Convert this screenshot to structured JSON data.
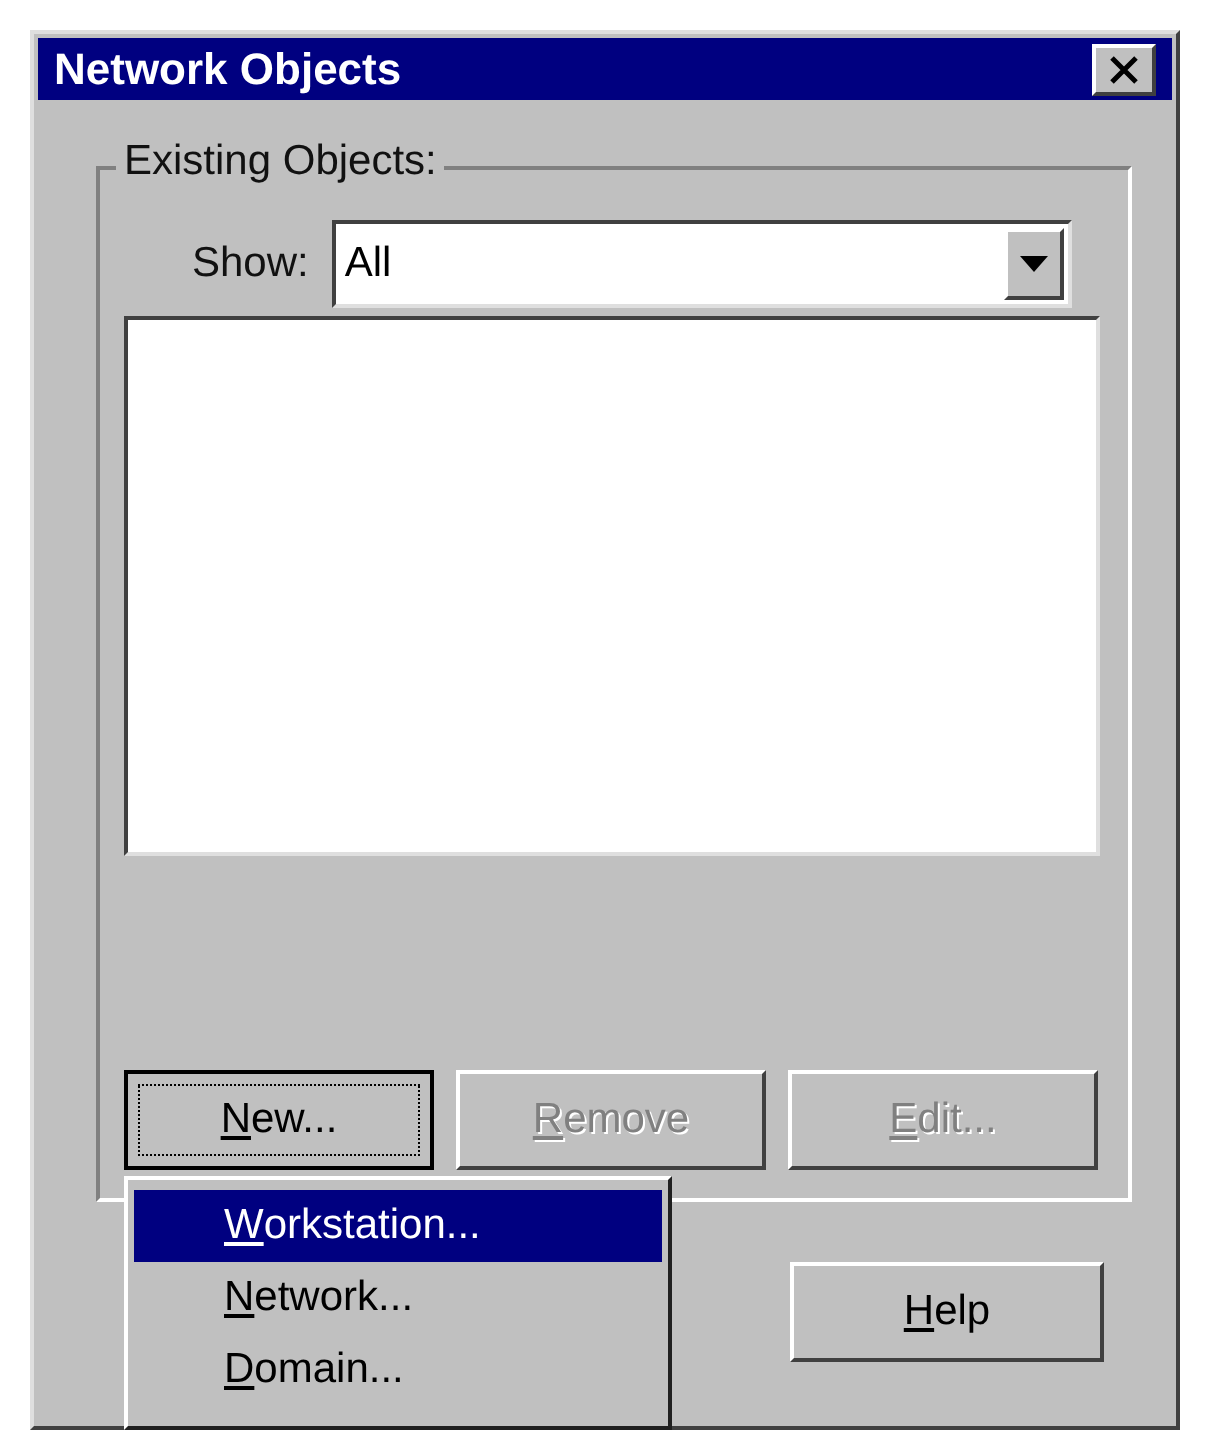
{
  "window": {
    "title": "Network Objects"
  },
  "group": {
    "title": "Existing Objects:",
    "show_label": "Show:",
    "show_value": "All"
  },
  "buttons": [
    {
      "label": "New...",
      "underline_first": true,
      "disabled": false,
      "focused": true
    },
    {
      "label": "Remove",
      "underline_first": true,
      "disabled": true,
      "focused": false
    },
    {
      "label": "Edit...",
      "underline_first": true,
      "disabled": true,
      "focused": false
    }
  ],
  "help_button": {
    "label": "Help",
    "underline_first": true
  },
  "menu": [
    {
      "label": "Workstation...",
      "underline_first": true,
      "selected": true
    },
    {
      "label": "Network...",
      "underline_first": true,
      "selected": false
    },
    {
      "label": "Domain...",
      "underline_first": true,
      "selected": false
    }
  ]
}
